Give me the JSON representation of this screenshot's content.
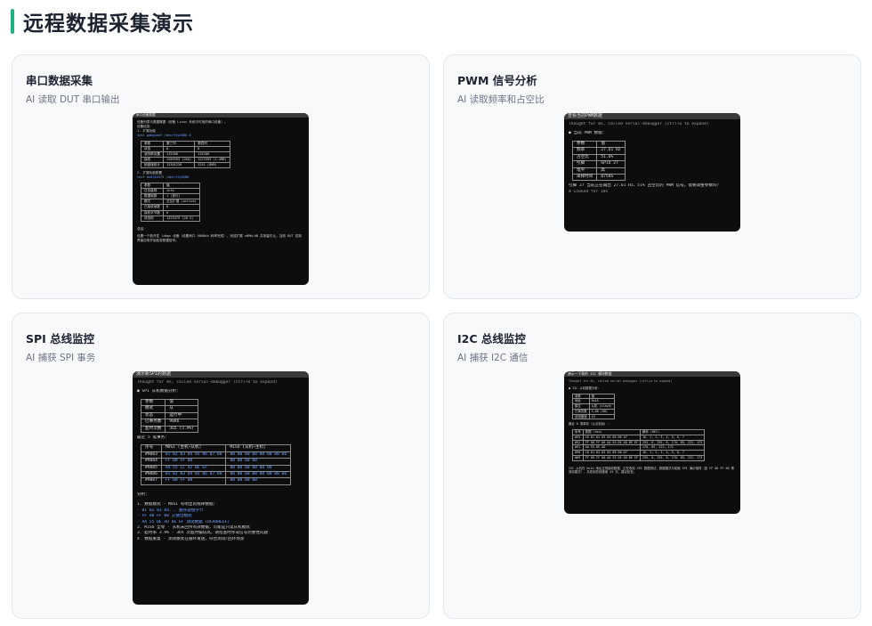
{
  "page": {
    "title": "远程数据采集演示"
  },
  "cards": [
    {
      "title": "串口数据采集",
      "subtitle": "AI 读取 DUT 串口输出"
    },
    {
      "title": "PWM 信号分析",
      "subtitle": "AI 读取频率和占空比"
    },
    {
      "title": "SPI 总线监控",
      "subtitle": "AI 捕获 SPI 事务"
    },
    {
      "title": "I2C 总线监控",
      "subtitle": "AI 捕获 I2C 通信"
    }
  ],
  "pwm_term": {
    "tab": "查看当前PWM数据",
    "thought": "Thought for 8s, called serial-debugger (ctrl+o to expand)",
    "heading": "● 当前 PWM 数据：",
    "rows": [
      [
        "参数",
        "值"
      ],
      [
        "频率",
        "27.61 Hz"
      ],
      [
        "占空比",
        "51.6%"
      ],
      [
        "引脚",
        "GPIO 27"
      ],
      [
        "电平",
        "高"
      ],
      [
        "采样时间",
        "0758S"
      ]
    ],
    "footer": "引脚 27 当前正在输出 27.61 Hz、51% 占空比的 PWM 信号。需要调整参数吗？",
    "cooked": "✻ Cooked for 10s"
  },
  "spi_term": {
    "tab": "演示新SPI的数据",
    "thought": "Thought for 8s, called serial-debugger (ctrl+o to expand)",
    "heading": "● SPI 从机数据分析：",
    "status_rows": [
      [
        "参数",
        "值"
      ],
      [
        "模式",
        "从"
      ],
      [
        "状态",
        "运行中"
      ],
      [
        "已事务数",
        "9086"
      ],
      [
        "超时次数",
        "365 (3.9%)"
      ]
    ],
    "recent_label": "最近 5 笔事务：",
    "tx_header": [
      "序号",
      "MOSI (主机→从机)",
      "MISO (从机→主机)"
    ],
    "tx_rows": [
      [
        "#9083",
        "01 02 03 04 05 06 07 08",
        "00 00 00 00 00 00 00 00"
      ],
      [
        "#9084",
        "FF 00 FF 00",
        "00 00 00 00"
      ],
      [
        "#9085",
        "AA 55 CC 42 BE EF",
        "00 00 00 00 00 00"
      ],
      [
        "#9086",
        "01 02 03 04 05 06 07 08",
        "00 00 00 00 00 00 00 00"
      ],
      [
        "#9087",
        "FF 00 FF 00",
        "00 00 00 00"
      ]
    ],
    "analysis_label": "分析：",
    "analysis": [
      "1. 数据模式 - MOSI 有明显的规律数据：",
      "  - 01 02 03 04... 顺序递增字节",
      "  - FF 00 FF 00 交替位模式",
      "  - AA 55 DE AD BE EF 测试数据 (DEADBEEF)",
      "2. MISO 全零 - 从机未回传有效数据，可能是只读从机模式",
      "3. 超时率 3.9% - 365 次超时偏较高，请检查时序或信号完整性问题",
      "4. 数据重复 - 测试模式在循环发送，符合测试/回环场景"
    ]
  },
  "serial_term": {
    "tab": "串口设备数据",
    "lines": [
      "设备列表与数据概要（设备 Linux 系统中可用的串口设备）。",
      "",
      "设备信息：",
      "",
      "1. 扩展功能",
      "test gdbgpadf /dev/ttyUSB0 0"
    ],
    "table1": [
      [
        "参数",
        "第三列",
        "第四列"
      ],
      [
        "状态",
        "0",
        "0"
      ],
      [
        "波特率设置",
        "115200",
        "115200"
      ],
      [
        "接收",
        "1209393 (2Kb)",
        "1223393 (1.4MB)"
      ],
      [
        "帧错误统计",
        "12301230",
        "1231 (8KB)"
      ]
    ],
    "mid_lines": [
      "2. 扩展功能配置",
      "test 0x0154475 /dev/ttyUSB0"
    ],
    "table2": [
      [
        "参数",
        "值"
      ],
      [
        "日志级别",
        "info"
      ],
      [
        "数据帧数",
        "1 (多行)"
      ],
      [
        "模式",
        "交互扩展 (active)"
      ],
      [
        "已接收帧数",
        "0"
      ],
      [
        "接收字节数",
        "0"
      ],
      [
        "状态码",
        "1323379 (28.3)"
      ]
    ],
    "footer": [
      "总结：",
      "设置一个新开发 ldbgx 设备（设置串口 9600kb 码率完成），完成扩展 ±0Mb/dB 并测量中止。当前 DUT 控制界面加电开始检查数据信号。"
    ]
  },
  "i2c_term": {
    "tab": "演示一下我的 I2C 模块数据",
    "thought": "Thought for 6s, called serial-debugger (ctrl+o to expand)",
    "heading": "● I2C 从机数据分析：",
    "status_rows": [
      [
        "参数",
        "值"
      ],
      [
        "地址",
        "0x1A"
      ],
      [
        "模式",
        "从机 (slave)"
      ],
      [
        "已事务数",
        "5,88 (88)"
      ],
      [
        "总线错误",
        "43"
      ]
    ],
    "recent_label": "最近 6 笔事务（从近到远）：",
    "tx_header": [
      "序号",
      "数据 (hex)",
      "解析 (DEC)"
    ],
    "tx_rows": [
      [
        "#93",
        "16 01 02 03 04 05 06 07",
        "16, 1, 2, 3, 4, 5, 6, 7"
      ],
      [
        "#92",
        "FF 00 FF 00 AA 55 DE AD BE EF",
        "255, 0, 255, 0, 170, 85, 222, 173"
      ],
      [
        "#91",
        "AA 55 DE AD",
        "170, 85, 222, 173"
      ],
      [
        "#90",
        "10 01 02 03 04 05 06 07",
        "16, 1, 2, 3, 4, 5, 6, 7"
      ],
      [
        "#89",
        "FF 00 FF 00 AA 55 DE AD BE EF",
        "255, 0, 255, 0, 170, 85, 222, 173"
      ]
    ],
    "footer": "I2C 从机在 0x1A 地址正常接收数据，正在收到 SPI 数据测试、数据模式与前面 SPI 演示相同（如 FF 00 FF 00 等测试模式），共收到总线错误 43 次，建议检查。"
  }
}
